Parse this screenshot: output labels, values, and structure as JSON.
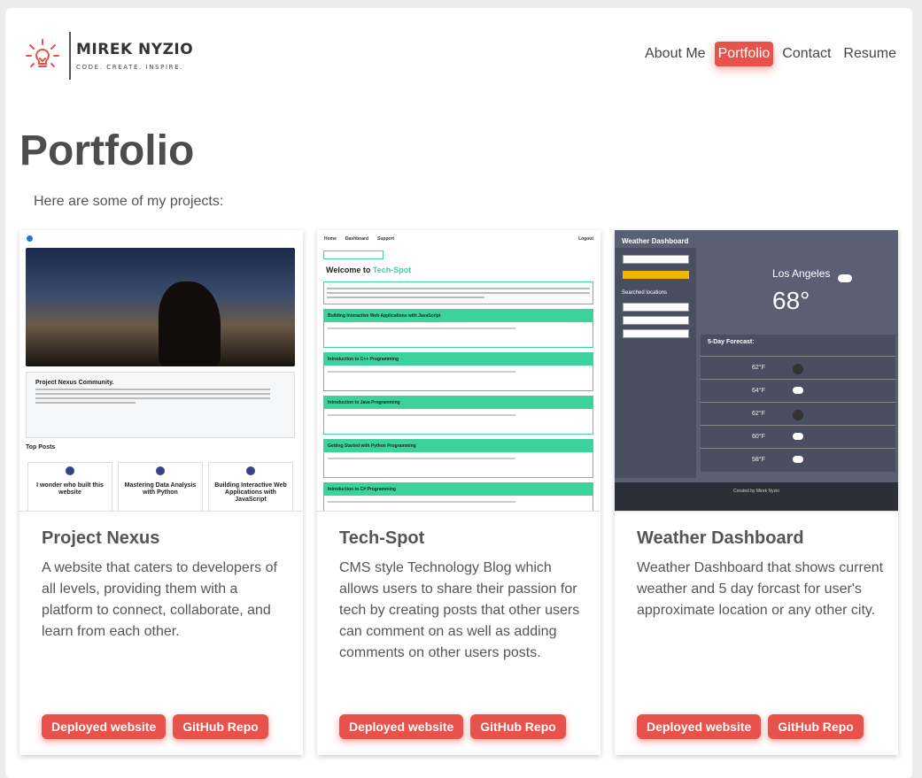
{
  "brand": {
    "name": "MIREK NYZIO",
    "tagline": "CODE. CREATE. INSPIRE.",
    "accent": "#e8524a"
  },
  "nav": {
    "items": [
      "About Me",
      "Portfolio",
      "Contact",
      "Resume"
    ],
    "active": "Portfolio"
  },
  "page": {
    "title": "Portfolio",
    "intro": "Here are some of my projects:"
  },
  "projects": [
    {
      "title": "Project Nexus",
      "description": "A website that caters to developers of all levels, providing them with a platform to connect, collaborate, and learn from each other.",
      "deploy_label": "Deployed website",
      "repo_label": "GitHub Repo"
    },
    {
      "title": "Tech-Spot",
      "description": "CMS style Technology Blog which allows users to share their passion for tech by creating posts that other users can comment on as well as adding comments on other users posts.",
      "deploy_label": "Deployed website",
      "repo_label": "GitHub Repo"
    },
    {
      "title": "Weather Dashboard",
      "description": "Weather Dashboard that shows current weather and 5 day forcast for user's approximate location or any other city.",
      "deploy_label": "Deployed website",
      "repo_label": "GitHub Repo"
    }
  ],
  "screenshots": {
    "nexus": {
      "community_heading": "Project Nexus Community.",
      "top_posts": "Top Posts",
      "posts": [
        "I wonder who built this website",
        "Mastering Data Analysis with Python",
        "Building Interactive Web Applications with JavaScript"
      ]
    },
    "techspot": {
      "nav": [
        "Home",
        "Dashboard",
        "Support"
      ],
      "logout": "Logout",
      "welcome": "Welcome to",
      "welcome_brand": "Tech-Spot",
      "posts": [
        "Building Interactive Web Applications with JavaScript",
        "Introduction to C++ Programming",
        "Introduction to Java Programming",
        "Getting Started with Python Programming",
        "Introduction to C# Programming"
      ]
    },
    "weather": {
      "title": "Weather Dashboard",
      "searched": "Searched locations",
      "city": "Los Angeles",
      "temp": "68°",
      "forecast_heading": "5-Day Forecast:",
      "forecast_temps": [
        "62°F",
        "64°F",
        "62°F",
        "60°F",
        "58°F"
      ],
      "footer": "Created by Mirek Nyzio"
    }
  }
}
